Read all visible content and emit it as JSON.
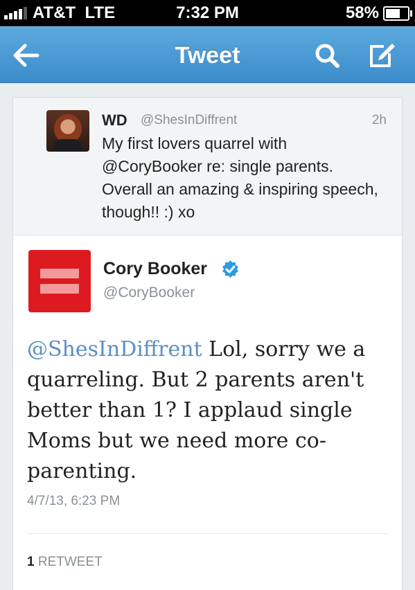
{
  "status_bar": {
    "carrier": "AT&T",
    "network": "LTE",
    "time": "7:32 PM",
    "battery": "58%",
    "battery_level": 0.58
  },
  "nav": {
    "title": "Tweet",
    "back_icon": "back-arrow-icon",
    "search_icon": "search-icon",
    "compose_icon": "compose-icon",
    "color": "#4597d4"
  },
  "reply_tweet": {
    "name": "WD",
    "handle": "@ShesInDiffrent",
    "time": "2h",
    "text": "My first lovers quarrel with @CoryBooker re: single parents. Overall an amazing & inspiring speech, though!! :) xo"
  },
  "main_tweet": {
    "name": "Cory Booker",
    "verified_icon": "verified-badge-icon",
    "handle": "@CoryBooker",
    "mention": "@ShesInDiffrent",
    "text": " Lol, sorry we a quarreling. But 2 parents aren't better than 1? I applaud single Moms but we need more co-parenting.",
    "timestamp": "4/7/13, 6:23 PM",
    "retweet_count": "1",
    "retweet_label": "RETWEET"
  }
}
